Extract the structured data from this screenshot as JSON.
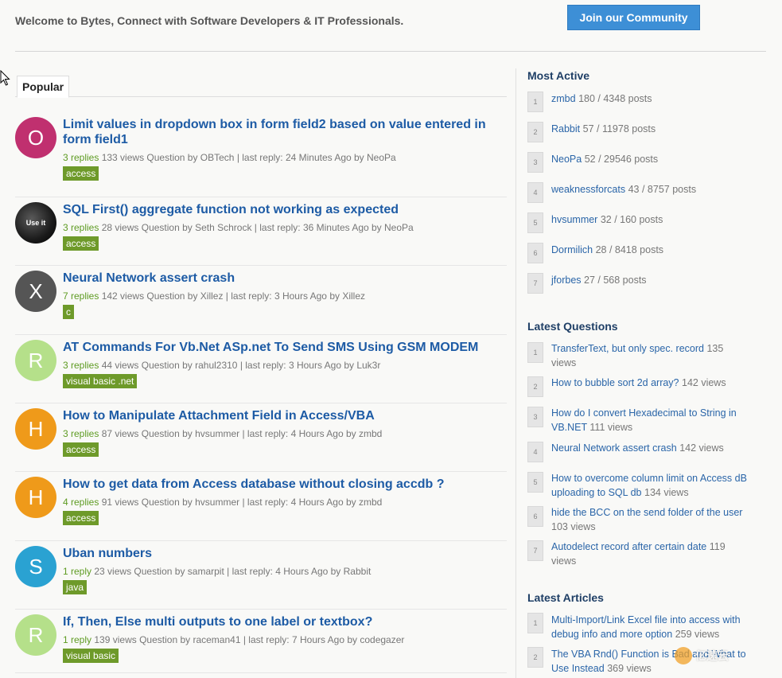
{
  "header": {
    "welcome": "Welcome to Bytes, Connect with Software Developers & IT Professionals.",
    "join_button": "Join our Community"
  },
  "tabs": [
    {
      "label": "Popular"
    }
  ],
  "topics": [
    {
      "avatar_letter": "O",
      "avatar_color": "#c0306f",
      "title": "Limit values in dropdown box in form field2 based on value entered in form field1",
      "replies": "3 replies",
      "views": "133 views",
      "meta": "Question by OBTech | last reply: 24 Minutes Ago by NeoPa",
      "tag": "access"
    },
    {
      "avatar_letter": "Use it",
      "avatar_color": "#000000",
      "title": "SQL First() aggregate function not working as expected",
      "replies": "3 replies",
      "views": "28 views",
      "meta": "Question by Seth Schrock | last reply: 36 Minutes Ago by NeoPa",
      "tag": "access"
    },
    {
      "avatar_letter": "X",
      "avatar_color": "#555555",
      "title": "Neural Network assert crash",
      "replies": "7 replies",
      "views": "142 views",
      "meta": "Question by Xillez | last reply: 3 Hours Ago by Xillez",
      "tag": "c"
    },
    {
      "avatar_letter": "R",
      "avatar_color": "#b5e08a",
      "title": "AT Commands For Vb.Net ASp.net To Send SMS Using GSM MODEM",
      "replies": "3 replies",
      "views": "44 views",
      "meta": "Question by rahul2310 | last reply: 3 Hours Ago by Luk3r",
      "tag": "visual basic .net"
    },
    {
      "avatar_letter": "H",
      "avatar_color": "#ef9a1a",
      "title": "How to Manipulate Attachment Field in Access/VBA",
      "replies": "3 replies",
      "views": "87 views",
      "meta": "Question by hvsummer | last reply: 4 Hours Ago by zmbd",
      "tag": "access"
    },
    {
      "avatar_letter": "H",
      "avatar_color": "#ef9a1a",
      "title": "How to get data from Access database without closing accdb ?",
      "replies": "4 replies",
      "views": "91 views",
      "meta": "Question by hvsummer | last reply: 4 Hours Ago by zmbd",
      "tag": "access"
    },
    {
      "avatar_letter": "S",
      "avatar_color": "#2aa2d2",
      "title": "Uban numbers",
      "replies": "1 reply",
      "views": "23 views",
      "meta": "Question by samarpit | last reply: 4 Hours Ago by Rabbit",
      "tag": "java"
    },
    {
      "avatar_letter": "R",
      "avatar_color": "#b5e08a",
      "title": "If, Then, Else multi outputs to one label or textbox?",
      "replies": "1 reply",
      "views": "139 views",
      "meta": "Question by raceman41 | last reply: 7 Hours Ago by codegazer",
      "tag": "visual basic"
    }
  ],
  "most_active": {
    "title": "Most Active",
    "items": [
      {
        "rank": "1",
        "name": "zmbd",
        "stats": "180 / 4348 posts"
      },
      {
        "rank": "2",
        "name": "Rabbit",
        "stats": "57 / 11978 posts"
      },
      {
        "rank": "3",
        "name": "NeoPa",
        "stats": "52 / 29546 posts"
      },
      {
        "rank": "4",
        "name": "weaknessforcats",
        "stats": "43 / 8757 posts"
      },
      {
        "rank": "5",
        "name": "hvsummer",
        "stats": "32 / 160 posts"
      },
      {
        "rank": "6",
        "name": "Dormilich",
        "stats": "28 / 8418 posts"
      },
      {
        "rank": "7",
        "name": "jforbes",
        "stats": "27 / 568 posts"
      }
    ]
  },
  "latest_questions": {
    "title": "Latest Questions",
    "items": [
      {
        "rank": "1",
        "title": "TransferText, but only spec. record",
        "views": "135 views"
      },
      {
        "rank": "2",
        "title": "How to bubble sort 2d array?",
        "views": "142 views"
      },
      {
        "rank": "3",
        "title": "How do I convert Hexadecimal to String in VB.NET",
        "views": "111 views"
      },
      {
        "rank": "4",
        "title": "Neural Network assert crash",
        "views": "142 views"
      },
      {
        "rank": "5",
        "title": "How to overcome column limit on Access dB uploading to SQL db",
        "views": "134 views"
      },
      {
        "rank": "6",
        "title": "hide the BCC on the send folder of the user",
        "views": "103 views"
      },
      {
        "rank": "7",
        "title": "Autodelect record after certain date",
        "views": "119 views"
      }
    ]
  },
  "latest_articles": {
    "title": "Latest Articles",
    "items": [
      {
        "rank": "1",
        "title": "Multi-Import/Link Excel file into access with debug info and more option",
        "views": "259 views"
      },
      {
        "rank": "2",
        "title": "The VBA Rnd() Function is Bad and What to Use Instead",
        "views": "369 views"
      }
    ]
  },
  "watermark": "亿速云"
}
